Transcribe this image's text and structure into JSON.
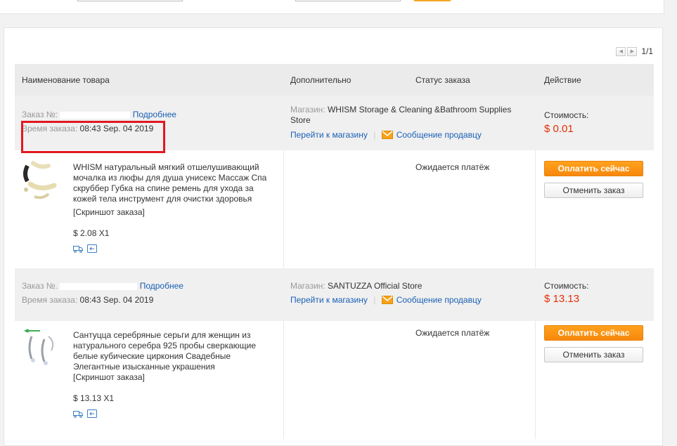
{
  "pagination": {
    "text": "1/1"
  },
  "table": {
    "headers": {
      "product": "Наименование товара",
      "additional": "Дополнительно",
      "status": "Статус заказа",
      "action": "Действие"
    }
  },
  "orders": [
    {
      "order_label": "Заказ №:",
      "details_link": "Подробнее",
      "time_label": "Время заказа:",
      "time_value": "08:43 Sep. 04 2019",
      "store_label": "Магазин:",
      "store_name": "WHISM Storage & Cleaning &Bathroom Supplies",
      "store_name_2": "Store",
      "goto_store": "Перейти к магазину",
      "message_seller": "Сообщение продавцу",
      "cost_label": "Стоимость:",
      "cost_value": "$ 0.01",
      "product_title": "WHISM натуральный мягкий отшелушивающий мочалка из люфы для душа унисекс Массаж Спа скруббер Губка на спине ремень для ухода за кожей тела инструмент для очистки здоровья",
      "snapshot": "[Скриншот заказа]",
      "unit_price": "$ 2.08 X1",
      "status": "Ожидается платёж",
      "pay_button": "Оплатить сейчас",
      "cancel_button": "Отменить заказ"
    },
    {
      "order_label": "Заказ №.",
      "details_link": "Подробнее",
      "time_label": "Время заказа:",
      "time_value": "08:43 Sep. 04 2019",
      "store_label": "Магазин:",
      "store_name": "SANTUZZA Official Store",
      "goto_store": "Перейти к магазину",
      "message_seller": "Сообщение продавцу",
      "cost_label": "Стоимость:",
      "cost_value": "$ 13.13",
      "product_title": "Сантуцца серебряные серьги для женщин из натурального серебра 925 пробы сверкающие белые кубические циркония Свадебные Элегантные изысканные украшения",
      "snapshot": "[Скриншот заказа]",
      "unit_price": "$ 13.13 X1",
      "status": "Ожидается платёж",
      "pay_button": "Оплатить сейчас",
      "cancel_button": "Отменить заказ"
    }
  ],
  "icons": {
    "pager_prev": "chevron-left-icon",
    "pager_next": "chevron-right-icon",
    "message": "envelope-icon",
    "shipping": "truck-icon",
    "return": "return-icon"
  },
  "colors": {
    "accent_orange": "#f7880c",
    "price_red": "#e62e04",
    "link_blue": "#1a5fb4",
    "highlight_red": "#e0191f"
  }
}
